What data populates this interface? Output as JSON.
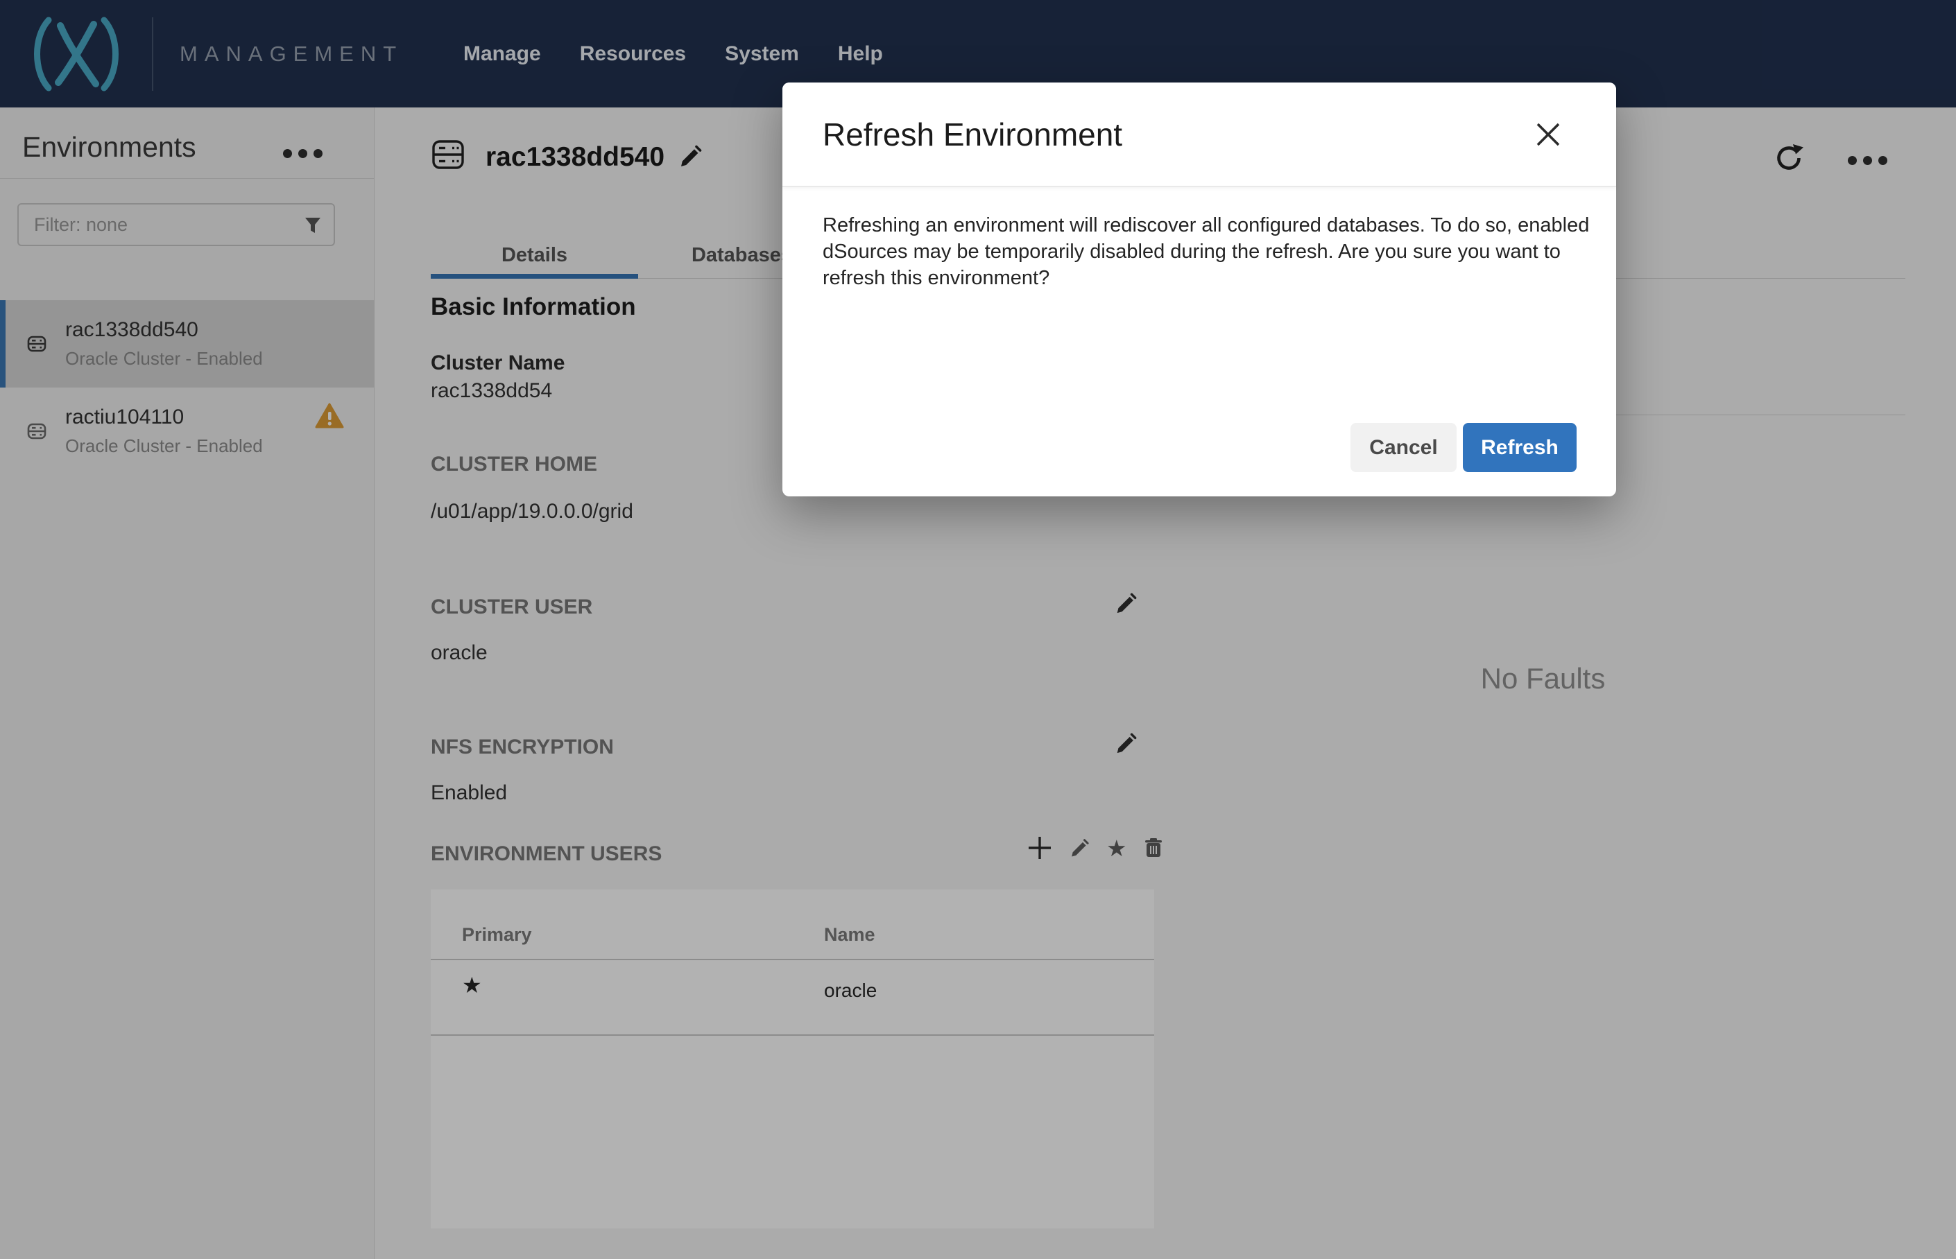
{
  "nav": {
    "brand": "MANAGEMENT",
    "items": [
      {
        "label": "Manage"
      },
      {
        "label": "Resources"
      },
      {
        "label": "System"
      },
      {
        "label": "Help"
      }
    ]
  },
  "sidebar": {
    "title": "Environments",
    "filter_placeholder": "Filter: none",
    "items": [
      {
        "name": "rac1338dd540",
        "subtitle": "Oracle Cluster - Enabled"
      },
      {
        "name": "ractiu104110",
        "subtitle": "Oracle Cluster - Enabled"
      }
    ]
  },
  "header": {
    "title": "rac1338dd540"
  },
  "tabs": [
    {
      "label": "Details"
    },
    {
      "label": "Databases"
    }
  ],
  "details": {
    "section_heading": "Basic Information",
    "cluster_name": {
      "label": "Cluster Name",
      "value": "rac1338dd54"
    },
    "cluster_home": {
      "label": "CLUSTER HOME",
      "value": "/u01/app/19.0.0.0/grid"
    },
    "cluster_user": {
      "label": "CLUSTER USER",
      "value": "oracle"
    },
    "nfs_encryption": {
      "label": "NFS ENCRYPTION",
      "value": "Enabled"
    },
    "environment_users": {
      "label": "ENVIRONMENT USERS"
    }
  },
  "users_table": {
    "columns": [
      {
        "label": "Primary"
      },
      {
        "label": "Name"
      }
    ],
    "rows": [
      {
        "primary": "★",
        "name": "oracle"
      }
    ]
  },
  "faults": {
    "empty_text": "No Faults"
  },
  "modal": {
    "title": "Refresh Environment",
    "body_lines": [
      "Refreshing an environment will rediscover all configured databases. To do so, enabled",
      "dSources may be temporarily disabled during the refresh. Are you sure you want to",
      "refresh this environment?"
    ],
    "cancel_label": "Cancel",
    "confirm_label": "Refresh"
  },
  "icons": {
    "primary_star": "★",
    "env_users_star": "★"
  },
  "colors": {
    "nav_bg": "#213150",
    "brand_teal": "#4aa9c6",
    "accent_blue": "#3174bd",
    "tab_underline_blue": "#3574b5",
    "selected_border_blue": "#3b77b3",
    "warning_orange": "#dc9b35"
  }
}
